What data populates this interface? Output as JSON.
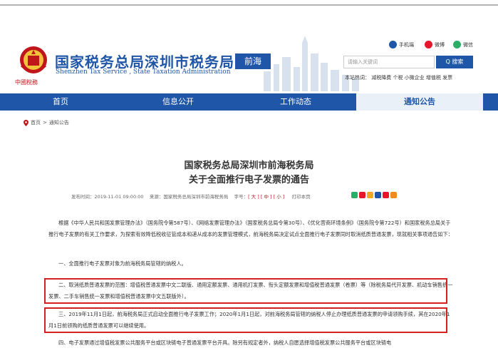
{
  "header": {
    "emblem_text": "中國稅務",
    "title": "国家税务总局深圳市税务局",
    "subtitle": "Shenzhen Tax Service , State Taxation Administration",
    "region_badge": "前海",
    "social": {
      "mobile": "手机端",
      "weibo": "微博",
      "wechat": "微信"
    },
    "search_placeholder": "请输入关键词",
    "search_button": "Q 搜索",
    "hot_words": "本站热词： 减税降费  个税  小微企业  增值税  发票"
  },
  "nav": {
    "items": [
      {
        "label": "首页"
      },
      {
        "label": "信息公开"
      },
      {
        "label": "工作动态"
      },
      {
        "label": "通知公告"
      }
    ]
  },
  "breadcrumb": {
    "home": "首页",
    "sep": ">",
    "current": "通知公告"
  },
  "article": {
    "title_line1": "国家税务总局深圳市前海税务局",
    "title_line2": "关于全面推行电子发票的通告",
    "meta": {
      "date": "发布时间：2019-11-01 09:00:00",
      "source": "来源：国家税务总局深圳市前海税务局",
      "font_label": "字号：",
      "font_sizes": "[ 大 ] [ 中 ] [ 小 ]",
      "print": "打印本页"
    },
    "p1": "根据《中华人民共和国发票管理办法》（国务院令第587号）、《网络发票管理办法》（国家税务总局令第30号）、《优化营商环境条例》（国务院令第722号）和国家税务总局关于推行电子发票的有关工作要求，为探索有效降低税收征管成本和递从成本的发票管理模式，前海税务局决定试点全面推行电子发票同时取消纸质普通发票，现就相关事项通告如下：",
    "p2": "一、全面推行电子发票对象为前海税务局管辖的纳税人。",
    "p3": "二、取消纸质普通发票的范围：增值税普通发票中文二联版、通用定额发票、通用机打发票、衔头定额发票和增值税普通发票（卷票）等（除税务局代开发票、机动车销售统一发票、二手车销售统一发票和增值税普通发票中文五联版外）。",
    "p4": "三、2019年11月1日起，前海税务局正式启动全面推行电子发票工作；2020年1月1日起，对前海税务局管辖的纳税人停止办理纸质普通发票的申请领购手续，其在2020年1月1日前领购的纸质普通发票可以继续使用。",
    "p5": "四、电子发票通过增值税发票公共服务平台或区块链电子普通发票平台开具。除另有规定者外，纳税人自愿选择增值税发票公共服务平台或区块链电"
  },
  "colors": {
    "brand_blue": "#1f56a8",
    "highlight_red": "#d42020"
  }
}
